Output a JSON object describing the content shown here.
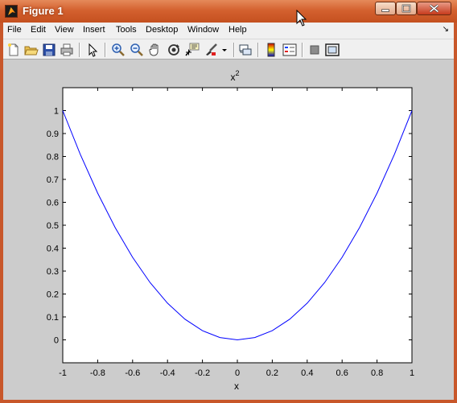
{
  "window": {
    "title": "Figure 1",
    "min_icon": "minimize-icon",
    "max_icon": "maximize-icon",
    "close_icon": "close-icon"
  },
  "menu": {
    "items": [
      "File",
      "Edit",
      "View",
      "Insert",
      "Tools",
      "Desktop",
      "Window",
      "Help"
    ],
    "overflow": "↘"
  },
  "toolbar": {
    "buttons": [
      "new-figure-icon",
      "open-file-icon",
      "save-icon",
      "print-icon",
      "edit-plot-arrow-icon",
      "zoom-in-icon",
      "zoom-out-icon",
      "pan-hand-icon",
      "rotate-3d-icon",
      "data-cursor-icon",
      "brush-icon",
      "brush-dropdown-icon",
      "link-plot-icon",
      "colorbar-icon",
      "legend-icon",
      "hide-plot-tools-icon",
      "show-plot-tools-icon"
    ]
  },
  "colors": {
    "titlebar": "#d4612f",
    "figure_bg": "#cccccc",
    "axes_bg": "#ffffff",
    "line": "#0000ff"
  },
  "chart_data": {
    "type": "line",
    "title_base": "x",
    "title_exponent": "2",
    "xlabel": "x",
    "ylabel": "",
    "xlim": [
      -1,
      1
    ],
    "ylim": [
      -0.1,
      1.1
    ],
    "xticks": [
      -1,
      -0.8,
      -0.6,
      -0.4,
      -0.2,
      0,
      0.2,
      0.4,
      0.6,
      0.8,
      1
    ],
    "xtick_labels": [
      "-1",
      "-0.8",
      "-0.6",
      "-0.4",
      "-0.2",
      "0",
      "0.2",
      "0.4",
      "0.6",
      "0.8",
      "1"
    ],
    "yticks": [
      0,
      0.1,
      0.2,
      0.3,
      0.4,
      0.5,
      0.6,
      0.7,
      0.8,
      0.9,
      1
    ],
    "ytick_labels": [
      "0",
      "0.1",
      "0.2",
      "0.3",
      "0.4",
      "0.5",
      "0.6",
      "0.7",
      "0.8",
      "0.9",
      "1"
    ],
    "grid": false,
    "series": [
      {
        "color": "#0000ff",
        "x": [
          -1,
          -0.9,
          -0.8,
          -0.7,
          -0.6,
          -0.5,
          -0.4,
          -0.3,
          -0.2,
          -0.1,
          0,
          0.1,
          0.2,
          0.3,
          0.4,
          0.5,
          0.6,
          0.7,
          0.8,
          0.9,
          1
        ],
        "y": [
          1,
          0.81,
          0.64,
          0.49,
          0.36,
          0.25,
          0.16,
          0.09,
          0.04,
          0.01,
          0,
          0.01,
          0.04,
          0.09,
          0.16,
          0.25,
          0.36,
          0.49,
          0.64,
          0.81,
          1
        ]
      }
    ]
  }
}
